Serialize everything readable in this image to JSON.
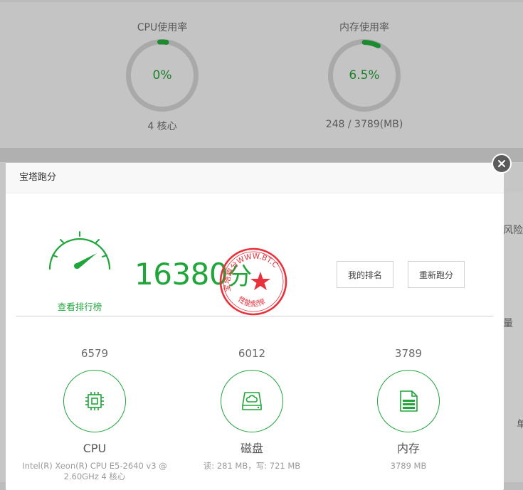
{
  "background": {
    "cpu_gauge": {
      "title": "CPU使用率",
      "value": "0%",
      "sub": "4 核心",
      "percent": 0
    },
    "mem_gauge": {
      "title": "内存使用率",
      "value": "6.5%",
      "sub": "248 / 3789(MB)",
      "percent": 6.5
    },
    "edge_texts": {
      "risk": "风险",
      "amount": "量",
      "unit": "单"
    }
  },
  "modal": {
    "title": "宝塔跑分",
    "close_icon": "close-icon",
    "total_score": "16380",
    "score_unit": "分",
    "view_ranking": "查看排行榜",
    "stamp_text": {
      "top": "宝塔跑分WWW.BT.CN",
      "bottom": "性能彪悍"
    },
    "buttons": {
      "my_rank": "我的排名",
      "rerun": "重新跑分"
    },
    "metrics": [
      {
        "score": "6579",
        "name": "CPU",
        "icon": "cpu-chip-icon",
        "detail": "Intel(R) Xeon(R) CPU E5-2640 v3 @ 2.60GHz 4 核心"
      },
      {
        "score": "6012",
        "name": "磁盘",
        "icon": "disk-cloud-icon",
        "detail": "读: 281 MB，写: 721 MB"
      },
      {
        "score": "3789",
        "name": "内存",
        "icon": "memory-doc-icon",
        "detail": "3789 MB"
      }
    ],
    "colors": {
      "accent": "#20a53a",
      "stamp": "#e8313b"
    }
  }
}
